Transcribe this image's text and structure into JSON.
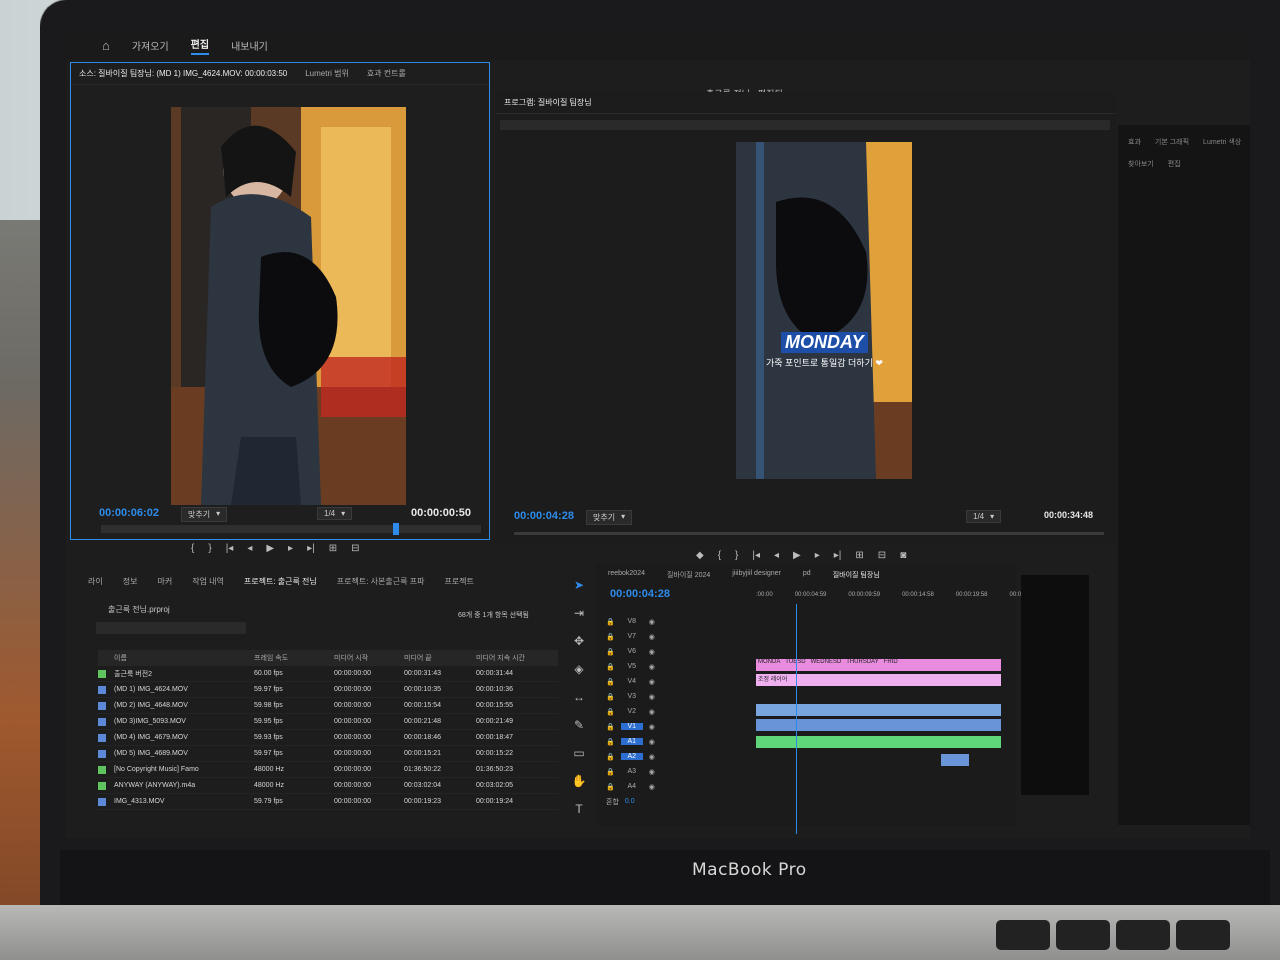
{
  "top_menu": {
    "items": [
      "가져오기",
      "편집",
      "내보내기"
    ],
    "active": "편집"
  },
  "window_title": "출근룩 전님 - 편집됨",
  "source_panel": {
    "tabs": [
      "소스: 질바이질 팀장님: (MD 1) IMG_4624.MOV: 00:00:03:50",
      "Lumetri 범위",
      "효과 컨트롤"
    ],
    "timecode_in": "00:00:06:02",
    "fit": "맞추기",
    "ratio": "1/4",
    "timecode_out": "00:00:00:50"
  },
  "program_panel": {
    "title": "프로그램: 질바이질 팀장님",
    "timecode": "00:00:04:28",
    "fit": "맞추기",
    "ratio": "1/4",
    "timecode_end": "00:00:34:48",
    "overlay_title": "MONDAY",
    "overlay_subtitle": "가죽 포인트로 통일감 더하기 ❤"
  },
  "right_panel": {
    "tabs": [
      "효과",
      "기본 그래픽",
      "Lumetri 색상"
    ],
    "sub_tabs": [
      "찾아보기",
      "편집"
    ]
  },
  "project_panel": {
    "tabs": [
      "라이",
      "정보",
      "마커",
      "작업 내역",
      "프로젝트: 출근룩 전님",
      "프로젝트: 사본출근룩 프파",
      "프로젝트"
    ],
    "file": "출근룩 전님.prproj",
    "selection": "68개 중 1개 항목 선택됨",
    "columns": [
      "이름",
      "프레임 속도",
      "미디어 시작",
      "미디어 끝",
      "미디어 지속 시간"
    ],
    "rows": [
      {
        "color": "#5fc35f",
        "name": "출근룩 버전2",
        "fps": "60.00 fps",
        "start": "00:00:00:00",
        "end": "00:00:31:43",
        "dur": "00:00:31:44"
      },
      {
        "color": "#5b8bd8",
        "name": "(MD 1) IMG_4624.MOV",
        "fps": "59.97 fps",
        "start": "00:00:00:00",
        "end": "00:00:10:35",
        "dur": "00:00:10:36"
      },
      {
        "color": "#5b8bd8",
        "name": "(MD 2) IMG_4648.MOV",
        "fps": "59.98 fps",
        "start": "00:00:00:00",
        "end": "00:00:15:54",
        "dur": "00:00:15:55"
      },
      {
        "color": "#5b8bd8",
        "name": "(MD 3)IMG_5093.MOV",
        "fps": "59.95 fps",
        "start": "00:00:00:00",
        "end": "00:00:21:48",
        "dur": "00:00:21:49"
      },
      {
        "color": "#5b8bd8",
        "name": "(MD 4) IMG_4679.MOV",
        "fps": "59.93 fps",
        "start": "00:00:00:00",
        "end": "00:00:18:46",
        "dur": "00:00:18:47"
      },
      {
        "color": "#5b8bd8",
        "name": "(MD 5) IMG_4689.MOV",
        "fps": "59.97 fps",
        "start": "00:00:00:00",
        "end": "00:00:15:21",
        "dur": "00:00:15:22"
      },
      {
        "color": "#5fc35f",
        "name": "[No Copyright Music] Famo",
        "fps": "48000 Hz",
        "start": "00:00:00:00",
        "end": "01:36:50:22",
        "dur": "01:36:50:23"
      },
      {
        "color": "#5fc35f",
        "name": "ANYWAY (ANYWAY).m4a",
        "fps": "48000 Hz",
        "start": "00:00:00:00",
        "end": "00:03:02:04",
        "dur": "00:03:02:05"
      },
      {
        "color": "#5b8bd8",
        "name": "IMG_4313.MOV",
        "fps": "59.79 fps",
        "start": "00:00:00:00",
        "end": "00:00:19:23",
        "dur": "00:00:19:24"
      }
    ]
  },
  "timeline": {
    "tabs": [
      "reebok2024",
      "질바이질 2024",
      "jiiibyjiil designer",
      "pd",
      "질바이질 팀장님"
    ],
    "active_tab": "질바이질 팀장님",
    "timecode": "00:00:04:28",
    "ruler": [
      ":00:00",
      "00:00:04:59",
      "00:00:09:59",
      "00:00:14:58",
      "00:00:19:58",
      "00:00:24:"
    ],
    "video_tracks": [
      "V8",
      "V7",
      "V6",
      "V5",
      "V4",
      "V3",
      "V2",
      "V1"
    ],
    "audio_tracks": [
      "A1",
      "A2",
      "A3",
      "A4"
    ],
    "mix_label": "혼합",
    "mix_value": "0.0",
    "clip_labels": [
      "MONDA",
      "TUESD",
      "WEDNESD",
      "THURSDAY",
      "FRID"
    ],
    "adjust_label": "조정 레이어"
  },
  "brand": "MacBook Pro"
}
